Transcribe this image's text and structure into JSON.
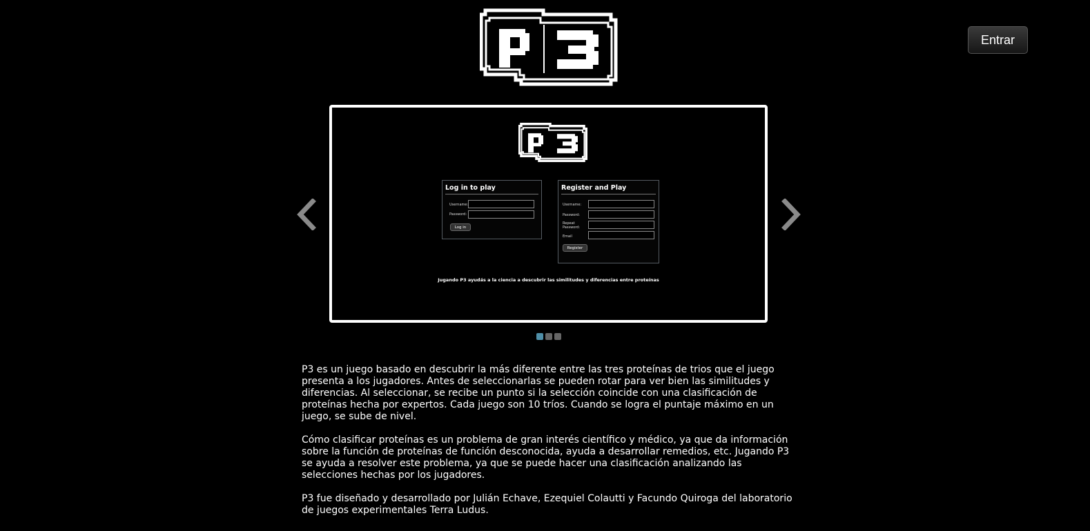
{
  "header": {
    "logo_text": "P3",
    "enter_label": "Entrar"
  },
  "slider": {
    "slide": {
      "logo_text": "P3",
      "login": {
        "title": "Log in to play",
        "username_label": "Username:",
        "password_label": "Password:",
        "button_label": "Log in"
      },
      "register": {
        "title": "Register and Play",
        "username_label": "Username:",
        "password_label": "Password:",
        "repeat_label": "Repeat Password:",
        "email_label": "Email",
        "button_label": "Register"
      },
      "caption": "Jugando P3 ayudás a la ciencia a descubrir las similitudes y diferencias entre proteínas"
    },
    "dots": {
      "count": 3,
      "active_index": 0
    },
    "prev_icon": "chevron-left-icon",
    "next_icon": "chevron-right-icon"
  },
  "description": {
    "paragraphs": [
      "P3 es un juego basado en descubrir la más diferente entre las tres proteínas de trios que el juego presenta a los jugadores. Antes de seleccionarlas se pueden rotar para ver bien las similitudes y diferencias. Al seleccionar, se recibe un punto si la selección coincide con una clasificación de proteínas hecha por expertos. Cada juego son 10 tríos. Cuando se logra el puntaje máximo en un juego, se sube de nivel.",
      "Cómo clasificar proteínas es un problema de gran interés científico y médico, ya que da información sobre la función de proteínas de función desconocida, ayuda a desarrollar remedios, etc. Jugando P3 se ayuda a resolver este problema, ya que se puede hacer una clasificación analizando las selecciones hechas por los jugadores.",
      "P3 fue diseñado y desarrollado por Julián Echave, Ezequiel Colautti y Facundo Quiroga del laboratorio de juegos experimentales Terra Ludus."
    ]
  },
  "colors": {
    "background": "#000000",
    "text": "#ffffff",
    "dot_active": "#4f8fa8",
    "dot_inactive": "#666666"
  }
}
